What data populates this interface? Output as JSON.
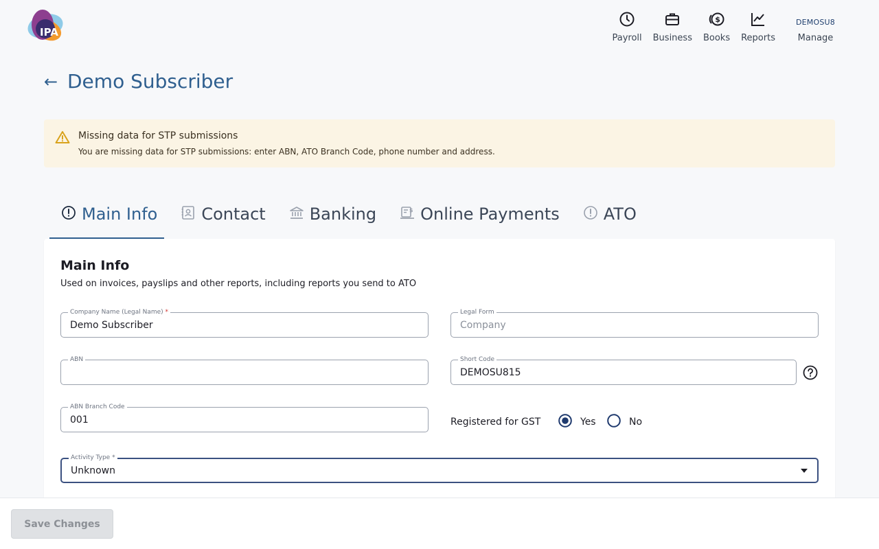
{
  "header": {
    "logo_text": "IPA",
    "nav": [
      {
        "label": "Payroll",
        "icon": "clock-icon"
      },
      {
        "label": "Business",
        "icon": "briefcase-icon"
      },
      {
        "label": "Books",
        "icon": "dollar-coin-icon"
      },
      {
        "label": "Reports",
        "icon": "line-chart-icon"
      }
    ],
    "user_code": "DEMOSU8",
    "manage_label": "Manage"
  },
  "page": {
    "back_label": "←",
    "title": "Demo Subscriber"
  },
  "alert": {
    "title": "Missing data for STP submissions",
    "text": "You are missing data for STP submissions: enter ABN, ATO Branch Code, phone number and address."
  },
  "tabs": [
    {
      "label": "Main Info",
      "icon": "alert-circle-icon",
      "active": true
    },
    {
      "label": "Contact",
      "icon": "contact-card-icon"
    },
    {
      "label": "Banking",
      "icon": "bank-icon"
    },
    {
      "label": "Online Payments",
      "icon": "payment-terminal-icon"
    },
    {
      "label": "ATO",
      "icon": "alert-circle-icon"
    }
  ],
  "main_info": {
    "title": "Main Info",
    "subtitle": "Used on invoices, payslips and other reports, including reports you send to ATO",
    "company_name": {
      "label": "Company Name (Legal Name)",
      "required_mark": "*",
      "value": "Demo Subscriber"
    },
    "legal_form": {
      "label": "Legal Form",
      "value": "Company"
    },
    "abn": {
      "label": "ABN",
      "value": ""
    },
    "short_code": {
      "label": "Short Code",
      "value": "DEMOSU815"
    },
    "abn_branch_code": {
      "label": "ABN Branch Code",
      "value": "001"
    },
    "gst": {
      "label": "Registered for GST",
      "yes_label": "Yes",
      "no_label": "No",
      "selected": "Yes"
    },
    "activity_type": {
      "label": "Activity Type",
      "required_mark": "*",
      "value": "Unknown"
    }
  },
  "footer": {
    "save_label": "Save Changes"
  },
  "colors": {
    "primary": "#2f5f8f",
    "alert_bg": "#fbf4e4",
    "warning": "#d9a21b",
    "radio_selected": "#1f3a6e"
  }
}
